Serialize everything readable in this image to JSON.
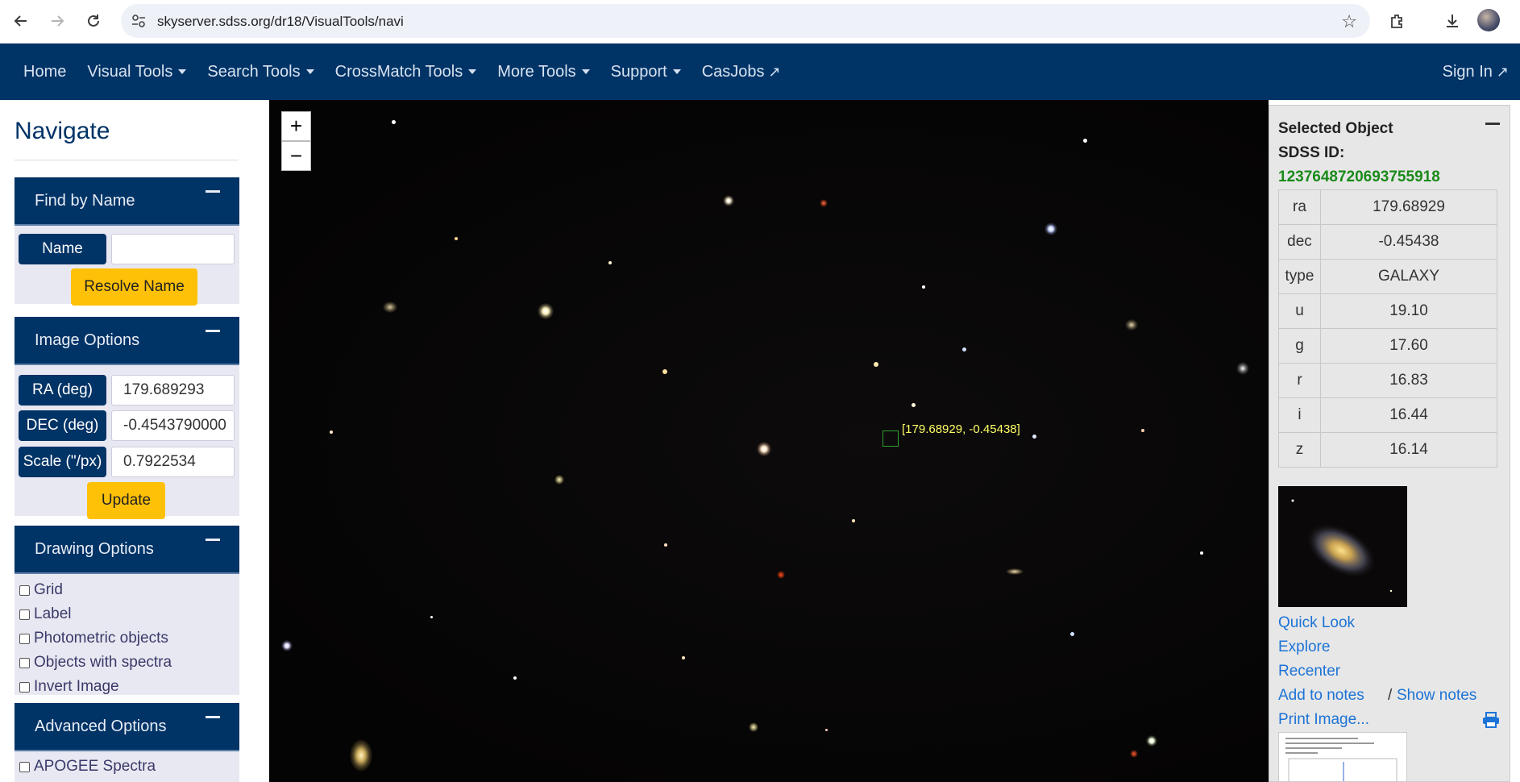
{
  "browser": {
    "url": "skyserver.sdss.org/dr18/VisualTools/navi",
    "back_icon": "arrow-left-icon",
    "forward_icon": "arrow-right-icon",
    "reload_icon": "reload-icon"
  },
  "nav": {
    "items": [
      {
        "label": "Home",
        "caret": false
      },
      {
        "label": "Visual Tools",
        "caret": true
      },
      {
        "label": "Search Tools",
        "caret": true
      },
      {
        "label": "CrossMatch Tools",
        "caret": true
      },
      {
        "label": "More Tools",
        "caret": true
      },
      {
        "label": "Support",
        "caret": true
      },
      {
        "label": "CasJobs",
        "caret": false
      }
    ],
    "signin": "Sign In",
    "bg_color": "#003366"
  },
  "left": {
    "title": "Navigate",
    "find_by_name": {
      "header": "Find by Name",
      "name_label": "Name",
      "name_value": "",
      "resolve_button": "Resolve Name"
    },
    "image_options": {
      "header": "Image Options",
      "ra_label": "RA (deg)",
      "ra_value": "179.689293",
      "dec_label": "DEC (deg)",
      "dec_value": "-0.4543790000",
      "scale_label": "Scale (\"/px)",
      "scale_value": "0.7922534",
      "update_button": "Update"
    },
    "drawing_options": {
      "header": "Drawing Options",
      "checkboxes": [
        "Grid",
        "Label",
        "Photometric objects",
        "Objects with spectra",
        "Invert Image"
      ]
    },
    "advanced_options": {
      "header": "Advanced Options",
      "checkboxes": [
        "APOGEE Spectra"
      ]
    }
  },
  "sky": {
    "zoom_in": "+",
    "zoom_out": "−",
    "marker_label": "[179.68929, -0.45438]"
  },
  "selected": {
    "title": "Selected Object",
    "sdss_label": "SDSS ID:",
    "sdss_id": "1237648720693755918",
    "props": [
      {
        "k": "ra",
        "v": "179.68929"
      },
      {
        "k": "dec",
        "v": "-0.45438"
      },
      {
        "k": "type",
        "v": "GALAXY"
      },
      {
        "k": "u",
        "v": "19.10"
      },
      {
        "k": "g",
        "v": "17.60"
      },
      {
        "k": "r",
        "v": "16.83"
      },
      {
        "k": "i",
        "v": "16.44"
      },
      {
        "k": "z",
        "v": "16.14"
      }
    ],
    "links": {
      "quick_look": "Quick Look",
      "explore": "Explore",
      "recenter": "Recenter",
      "add_notes": "Add to notes",
      "separator": "/",
      "show_notes": "Show notes",
      "print": "Print Image..."
    }
  }
}
